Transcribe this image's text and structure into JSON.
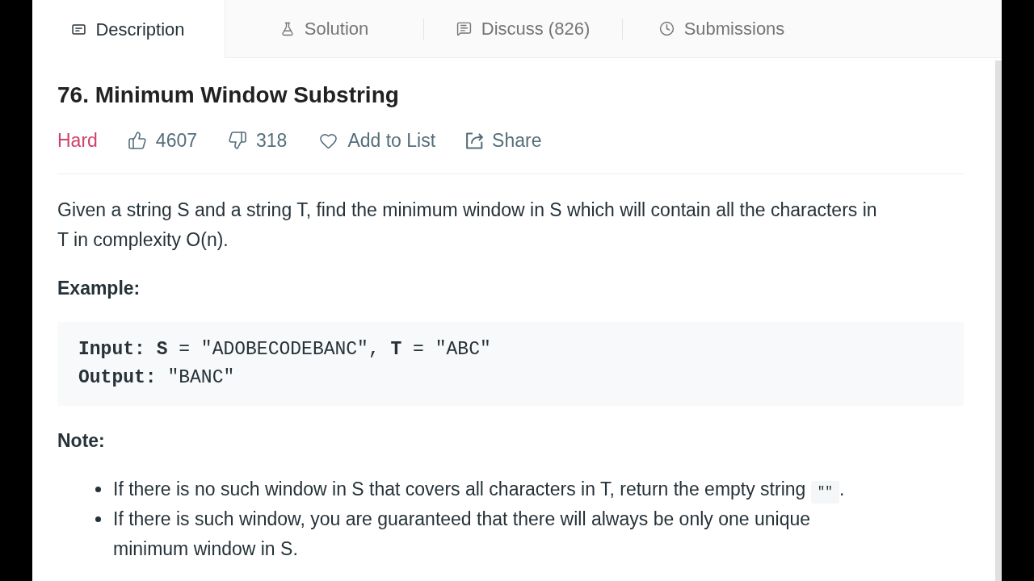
{
  "tabs": [
    {
      "label": "Description",
      "selected": true
    },
    {
      "label": "Solution",
      "selected": false
    },
    {
      "label": "Discuss (826)",
      "selected": false
    },
    {
      "label": "Submissions",
      "selected": false
    }
  ],
  "problem": {
    "title": "76. Minimum Window Substring",
    "difficulty": "Hard",
    "likes": "4607",
    "dislikes": "318",
    "add_to_list": "Add to List",
    "share": "Share"
  },
  "description": "Given a string S and a string T, find the minimum window in S which will contain all the characters in T in complexity O(n).",
  "example": {
    "heading": "Example:",
    "code_lines": [
      "**Input:** **S** = \"ADOBECODEBANC\", **T** = \"ABC\"",
      "**Output:** \"BANC\""
    ]
  },
  "note": {
    "heading": "Note:",
    "items": [
      {
        "text": "If there is no such window in S that covers all characters in T, return the empty string ",
        "code": "\"\"",
        "after": "."
      },
      {
        "text": "If there is such window, you are guaranteed that there will always be only one unique minimum window in S."
      }
    ]
  }
}
